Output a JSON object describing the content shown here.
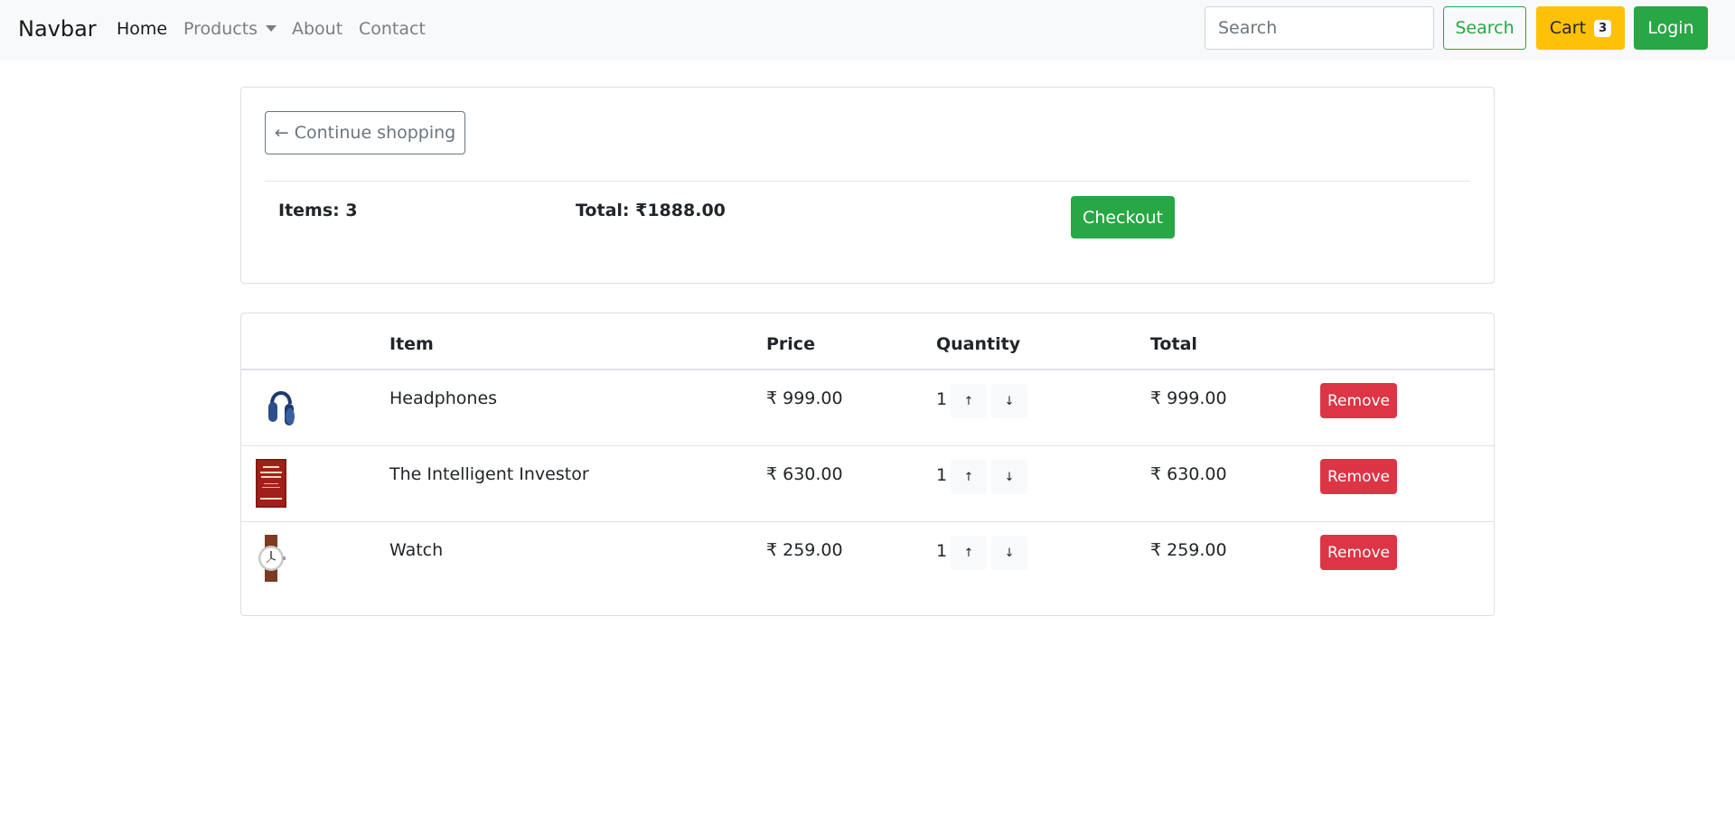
{
  "navbar": {
    "brand": "Navbar",
    "links": [
      {
        "label": "Home"
      },
      {
        "label": "Products"
      },
      {
        "label": "About"
      },
      {
        "label": "Contact"
      }
    ],
    "search_placeholder": "Search",
    "search_button": "Search",
    "cart_label": "Cart",
    "cart_count": "3",
    "login_label": "Login"
  },
  "summary": {
    "continue_label": "← Continue shopping",
    "items_text": "Items: 3",
    "total_text": "Total: ₹1888.00",
    "checkout_label": "Checkout"
  },
  "table": {
    "headers": {
      "item": "Item",
      "price": "Price",
      "quantity": "Quantity",
      "total": "Total"
    },
    "rows": [
      {
        "name": "Headphones",
        "price": "₹ 999.00",
        "qty": "1",
        "total": "₹ 999.00",
        "remove": "Remove",
        "up": "↑",
        "down": "↓",
        "thumb_icon": "headphones-icon"
      },
      {
        "name": "The Intelligent Investor",
        "price": "₹ 630.00",
        "qty": "1",
        "total": "₹ 630.00",
        "remove": "Remove",
        "up": "↑",
        "down": "↓",
        "thumb_icon": "book-icon"
      },
      {
        "name": "Watch",
        "price": "₹ 259.00",
        "qty": "1",
        "total": "₹ 259.00",
        "remove": "Remove",
        "up": "↑",
        "down": "↓",
        "thumb_icon": "watch-icon"
      }
    ]
  },
  "colors": {
    "success": "#28a745",
    "warning": "#ffc107",
    "danger": "#dc3545",
    "secondary": "#6c757d",
    "navbar_bg": "#f8f9fa"
  }
}
